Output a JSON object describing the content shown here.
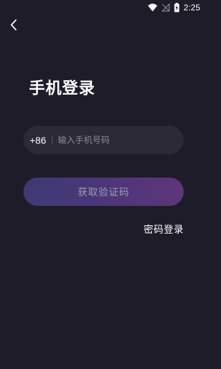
{
  "status_bar": {
    "time": "2:25",
    "icons": [
      "wifi-icon",
      "no-signal-icon",
      "battery-charging-icon"
    ]
  },
  "header": {
    "back_icon": "chevron-left-icon",
    "title": "手机登录"
  },
  "phone_field": {
    "country_code": "+86",
    "value": "",
    "placeholder": "输入手机号码"
  },
  "actions": {
    "get_code_label": "获取验证码",
    "password_login_label": "密码登录"
  },
  "colors": {
    "background": "#1f1c2a",
    "field_background": "#2d2a38",
    "button_gradient_start": "#3e3a73",
    "button_gradient_end": "#5e3679",
    "button_text": "#9f9cb0",
    "placeholder_text": "#8b8896"
  }
}
